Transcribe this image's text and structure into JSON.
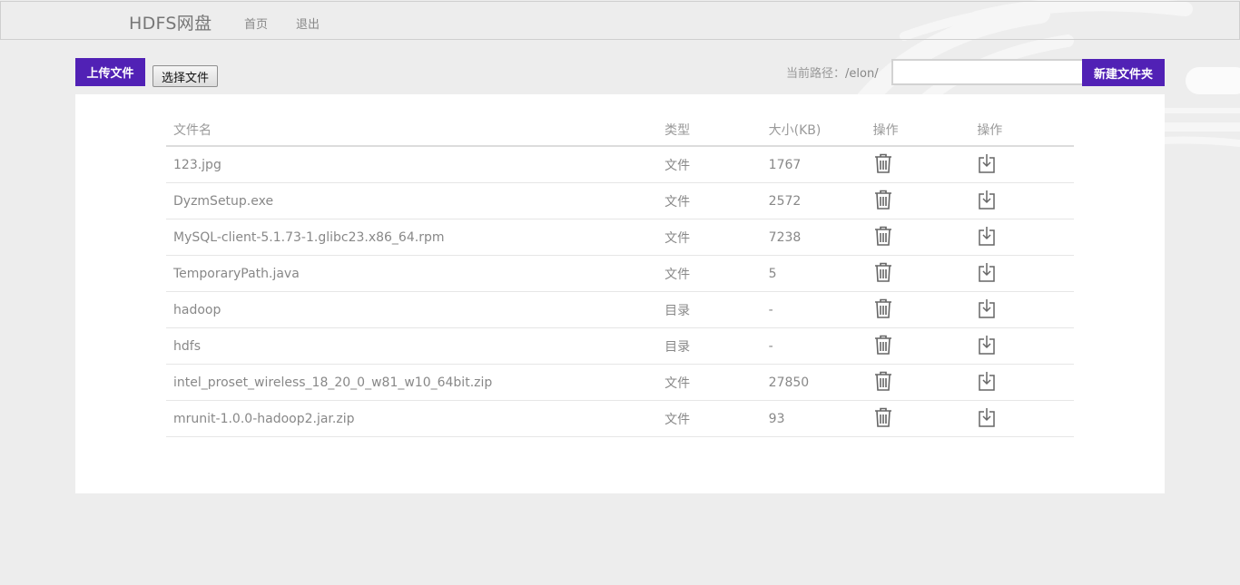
{
  "navbar": {
    "brand": "HDFS网盘",
    "home": "首页",
    "logout": "退出"
  },
  "toolbar": {
    "upload_label": "上传文件",
    "choose_file_label": "选择文件",
    "path_label": "当前路径：",
    "path_value": "/elon/",
    "folder_input_value": "",
    "newfolder_label": "新建文件夹"
  },
  "table": {
    "headers": [
      "文件名",
      "类型",
      "大小(KB)",
      "操作",
      "操作"
    ],
    "rows": [
      {
        "name": "123.jpg",
        "type": "文件",
        "size": "1767",
        "is_dir": false
      },
      {
        "name": "DyzmSetup.exe",
        "type": "文件",
        "size": "2572",
        "is_dir": false
      },
      {
        "name": "MySQL-client-5.1.73-1.glibc23.x86_64.rpm",
        "type": "文件",
        "size": "7238",
        "is_dir": false
      },
      {
        "name": "TemporaryPath.java",
        "type": "文件",
        "size": "5",
        "is_dir": false
      },
      {
        "name": "hadoop",
        "type": "目录",
        "size": "-",
        "is_dir": true
      },
      {
        "name": "hdfs",
        "type": "目录",
        "size": "-",
        "is_dir": true
      },
      {
        "name": "intel_proset_wireless_18_20_0_w81_w10_64bit.zip",
        "type": "文件",
        "size": "27850",
        "is_dir": false
      },
      {
        "name": "mrunit-1.0.0-hadoop2.jar.zip",
        "type": "文件",
        "size": "93",
        "is_dir": false
      }
    ]
  },
  "icons": {
    "delete": "trash-icon",
    "download": "download-icon"
  },
  "colors": {
    "accent": "#5121b5",
    "dir_link": "#5a35c7",
    "background": "#ededed"
  }
}
